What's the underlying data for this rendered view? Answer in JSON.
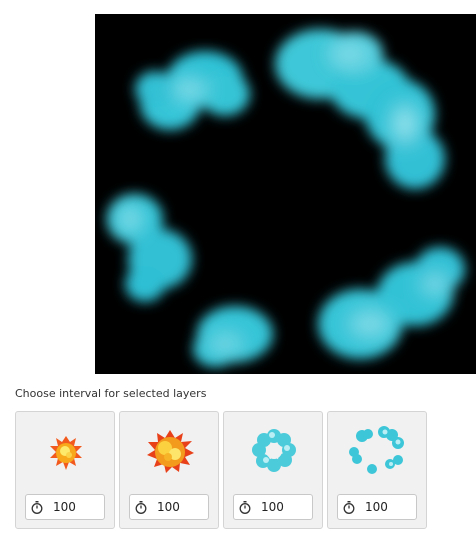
{
  "preview": {
    "background": "#000000",
    "effect_color": "#3cc6d8"
  },
  "caption": "Choose interval for selected layers",
  "frames": [
    {
      "thumbnail": "explosion-small-icon",
      "interval": "100",
      "selected": false
    },
    {
      "thumbnail": "explosion-large-icon",
      "interval": "100",
      "selected": false
    },
    {
      "thumbnail": "smoke-ring-small-icon",
      "interval": "100",
      "selected": false
    },
    {
      "thumbnail": "smoke-ring-large-icon",
      "interval": "100",
      "selected": false
    }
  ],
  "icons": {
    "interval": "stopwatch-icon"
  }
}
